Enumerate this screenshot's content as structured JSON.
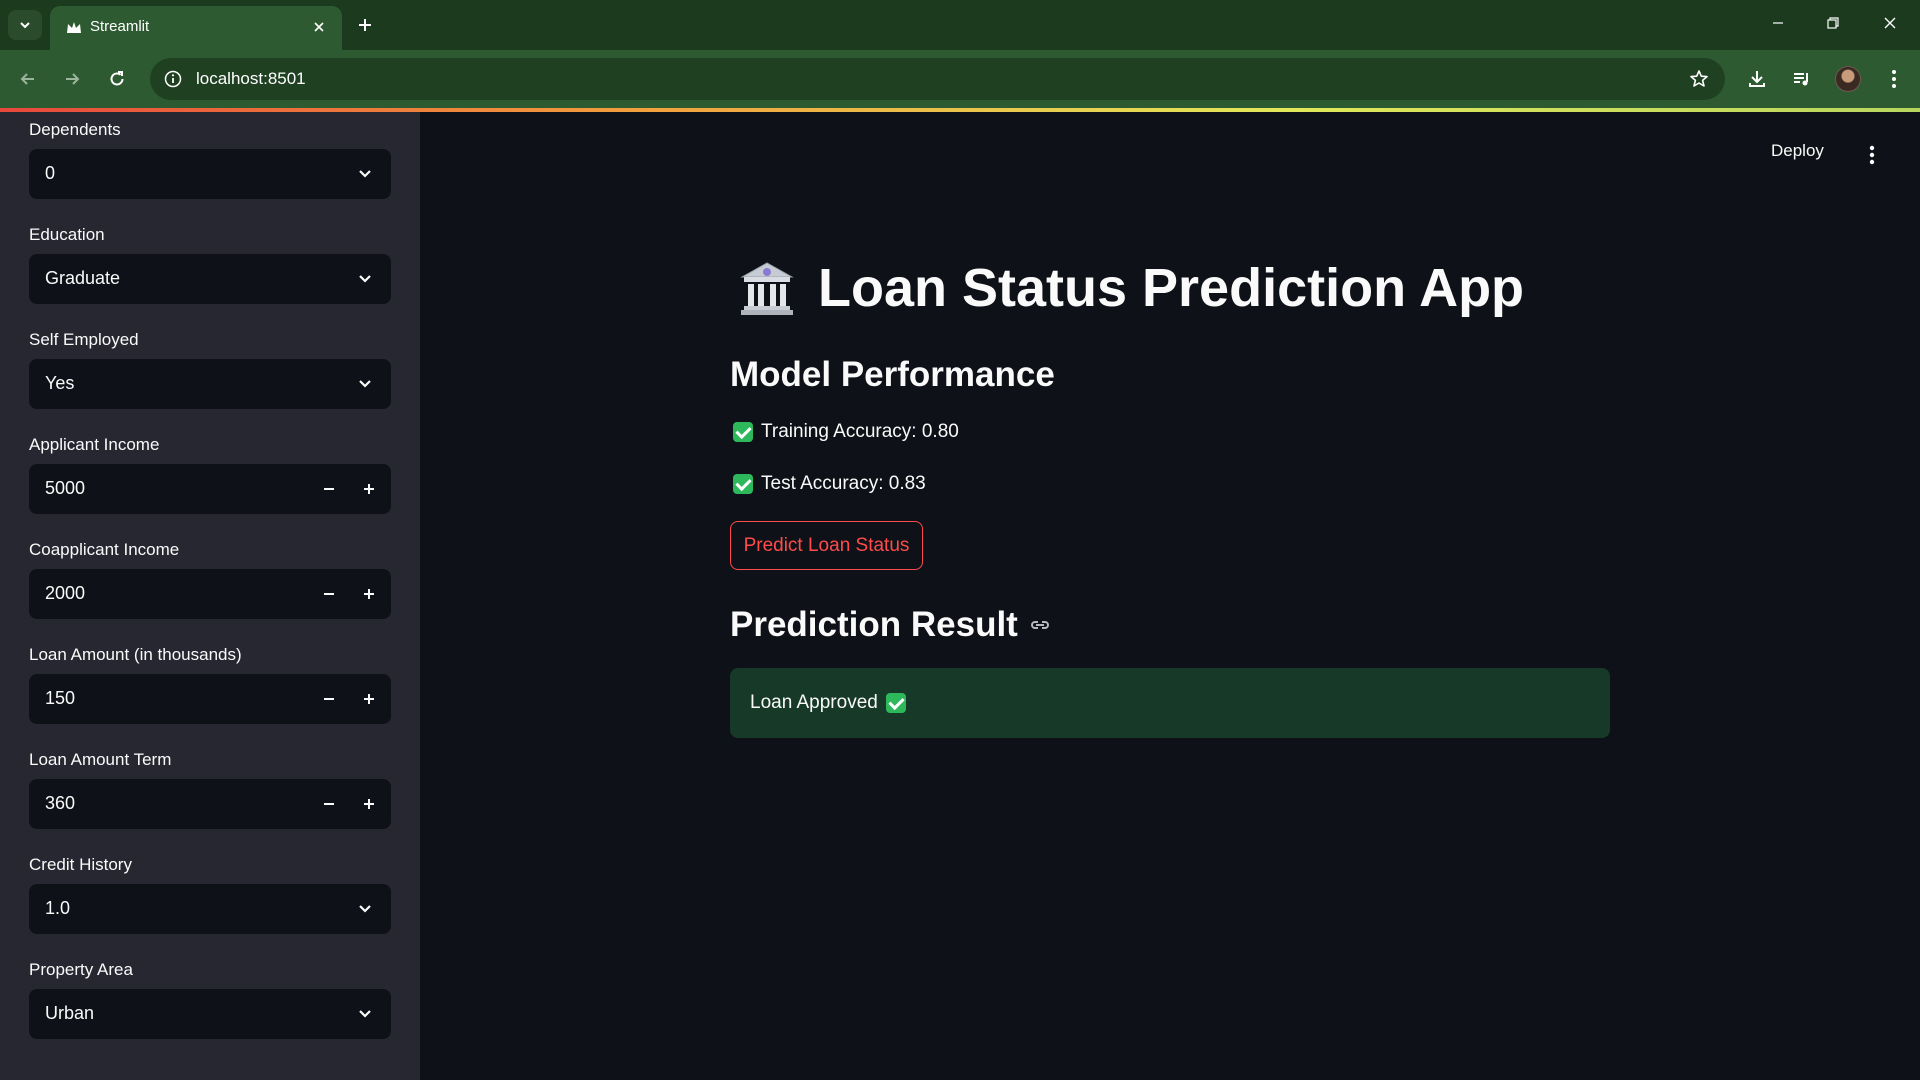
{
  "browser": {
    "tab_title": "Streamlit",
    "url": "localhost:8501"
  },
  "header": {
    "deploy_label": "Deploy"
  },
  "sidebar": {
    "fields": [
      {
        "label": "Dependents",
        "type": "select",
        "value": "0"
      },
      {
        "label": "Education",
        "type": "select",
        "value": "Graduate"
      },
      {
        "label": "Self Employed",
        "type": "select",
        "value": "Yes"
      },
      {
        "label": "Applicant Income",
        "type": "number",
        "value": "5000"
      },
      {
        "label": "Coapplicant Income",
        "type": "number",
        "value": "2000"
      },
      {
        "label": "Loan Amount (in thousands)",
        "type": "number",
        "value": "150"
      },
      {
        "label": "Loan Amount Term",
        "type": "number",
        "value": "360"
      },
      {
        "label": "Credit History",
        "type": "select",
        "value": "1.0"
      },
      {
        "label": "Property Area",
        "type": "select",
        "value": "Urban"
      }
    ]
  },
  "main": {
    "title": "Loan Status Prediction App",
    "title_icon": "bank-icon",
    "performance_heading": "Model Performance",
    "training_accuracy": "Training Accuracy: 0.80",
    "test_accuracy": "Test Accuracy: 0.83",
    "predict_button": "Predict Loan Status",
    "result_heading": "Prediction Result",
    "result_text": "Loan Approved"
  },
  "colors": {
    "accent": "#ff4b4b",
    "success_bg": "#173928",
    "check": "#2eb85c",
    "sidebar_bg": "#262730",
    "main_bg": "#0e1117",
    "browser_frame": "#2d5a30"
  }
}
